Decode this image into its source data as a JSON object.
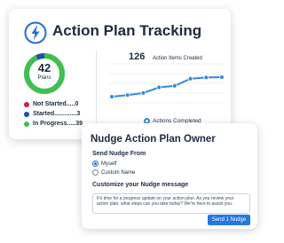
{
  "tracking_card": {
    "title": "Action Plan Tracking",
    "logo_icon": "lightning-bolt-icon",
    "donut": {
      "total": "42",
      "unit": "Plans",
      "segments": [
        {
          "name": "In Progress",
          "value": 39,
          "color": "#3fbf4f"
        },
        {
          "name": "Started",
          "value": 3,
          "color": "#1f4fa8"
        },
        {
          "name": "Not Started",
          "value": 0,
          "color": "#c8213a"
        }
      ]
    },
    "legend": [
      {
        "label": "Not Started.....0",
        "color": "#c8213a"
      },
      {
        "label": "Started.............3",
        "color": "#1f4fa8"
      },
      {
        "label": "In Progress.....39",
        "color": "#3fbf4f"
      }
    ]
  },
  "chart_data": {
    "type": "line",
    "headline_value": "126",
    "headline_label": "Action Items Created",
    "series": [
      {
        "name": "Actions Completed",
        "values": [
          20,
          25,
          32,
          50,
          55,
          78,
          82,
          83
        ],
        "color": "#2d8ae0"
      }
    ],
    "ylim": [
      0,
      126
    ],
    "grid": true
  },
  "nudge_card": {
    "title": "Nudge Action Plan Owner",
    "send_from_label": "Send Nudge From",
    "options": [
      {
        "label": "Myself",
        "checked": true
      },
      {
        "label": "Custom Name",
        "checked": false
      }
    ],
    "message_label": "Customize your Nudge message",
    "message": "It's time for a progress update on your action plan. As you review your action plan, what steps can you take today? We're here to assist you.",
    "button_label": "Send 1 Nudge"
  }
}
